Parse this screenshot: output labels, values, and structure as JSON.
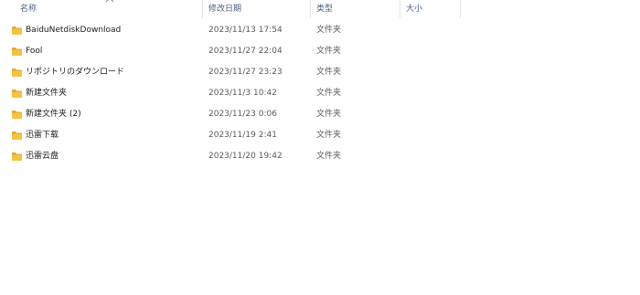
{
  "columns": {
    "name": "名称",
    "date": "修改日期",
    "type": "类型",
    "size": "大小"
  },
  "sort": {
    "column": "name",
    "direction": "ascending",
    "icon": "chevron-up-icon"
  },
  "files": [
    {
      "name": "BaiduNetdiskDownload",
      "date": "2023/11/13 17:54",
      "type": "文件夹",
      "size": "",
      "icon": "folder-icon"
    },
    {
      "name": "Fool",
      "date": "2023/11/27 22:04",
      "type": "文件夹",
      "size": "",
      "icon": "folder-icon"
    },
    {
      "name": "リポジトリのダウンロード",
      "date": "2023/11/27 23:23",
      "type": "文件夹",
      "size": "",
      "icon": "folder-icon"
    },
    {
      "name": "新建文件夹",
      "date": "2023/11/3 10:42",
      "type": "文件夹",
      "size": "",
      "icon": "folder-icon"
    },
    {
      "name": "新建文件夹 (2)",
      "date": "2023/11/23 0:06",
      "type": "文件夹",
      "size": "",
      "icon": "folder-icon"
    },
    {
      "name": "迅雷下载",
      "date": "2023/11/19 2:41",
      "type": "文件夹",
      "size": "",
      "icon": "folder-icon"
    },
    {
      "name": "迅雷云盘",
      "date": "2023/11/20 19:42",
      "type": "文件夹",
      "size": "",
      "icon": "folder-icon"
    }
  ],
  "colors": {
    "folder_body": "#f5c342",
    "folder_tab": "#e0a82e",
    "header_text": "#4c607a"
  }
}
